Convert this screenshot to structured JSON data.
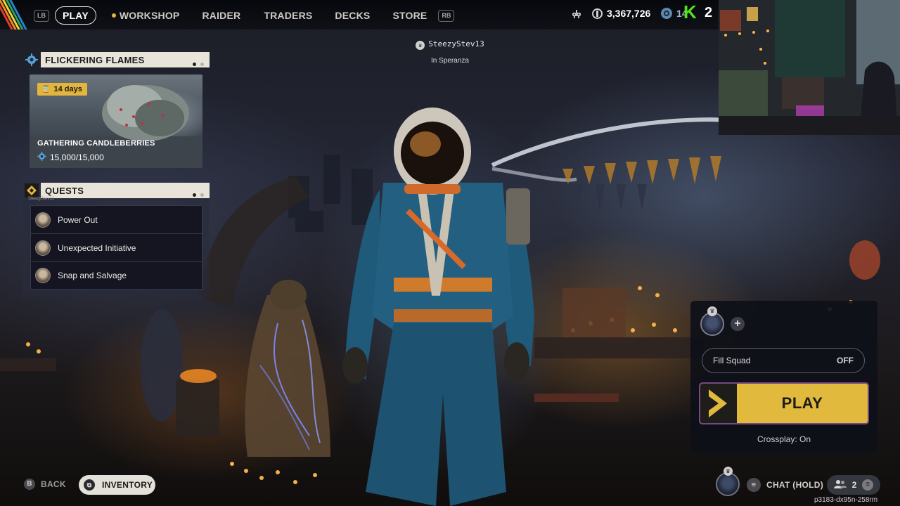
{
  "nav": {
    "lb_label": "LB",
    "rb_label": "RB",
    "items": [
      {
        "label": "PLAY",
        "active": true
      },
      {
        "label": "WORKSHOP",
        "active": false,
        "dot": true
      },
      {
        "label": "RAIDER",
        "active": false
      },
      {
        "label": "TRADERS",
        "active": false
      },
      {
        "label": "DECKS",
        "active": false
      },
      {
        "label": "STORE",
        "active": false
      }
    ]
  },
  "currency": {
    "coins_value": "3,367,726",
    "premium_value": "14",
    "icons": [
      "controller-icon",
      "coins-icon",
      "premium-currency-icon"
    ]
  },
  "overlay": {
    "logo_letter": "K",
    "logo_number": "2",
    "logo_color": "#53e21f"
  },
  "player": {
    "name": "SteezyStev13",
    "location": "In Speranza"
  },
  "event": {
    "header": "FLICKERING FLAMES",
    "days": "14 days",
    "title": "GATHERING CANDLEBERRIES",
    "progress": "15,000/15,000",
    "accent": "#e3b53d"
  },
  "quests": {
    "header": "QUESTS",
    "tag": "SteezyStev13",
    "items": [
      {
        "label": "Power Out"
      },
      {
        "label": "Unexpected Initiative"
      },
      {
        "label": "Snap and Salvage"
      }
    ]
  },
  "squad": {
    "fill_label": "Fill Squad",
    "fill_state": "OFF",
    "play_label": "PLAY",
    "crossplay": "Crossplay: On",
    "play_color": "#e0b93d"
  },
  "bottom": {
    "back_key": "B",
    "back_label": "BACK",
    "inventory_label": "INVENTORY",
    "chat_label": "CHAT (HOLD)",
    "friends_count": "2",
    "session_id": "p3183-dx95n-258rm"
  }
}
